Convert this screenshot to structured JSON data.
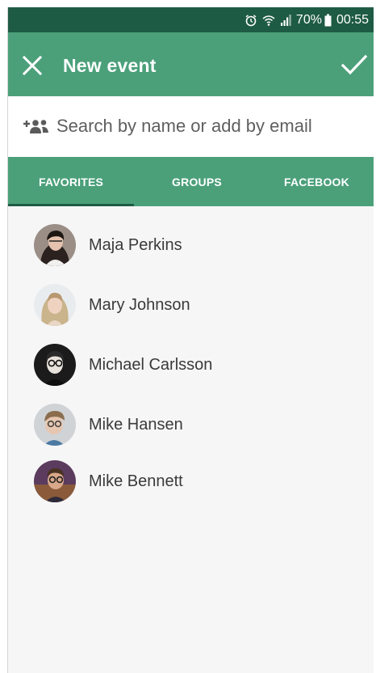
{
  "status_bar": {
    "battery": "70%",
    "time": "00:55",
    "icons": [
      "alarm-icon",
      "wifi-icon",
      "signal-icon",
      "battery-icon"
    ]
  },
  "app_bar": {
    "title": "New event",
    "close_icon": "close-icon",
    "confirm_icon": "check-icon"
  },
  "search": {
    "placeholder": "Search by name or add by email",
    "value": "",
    "icon": "add-people-icon"
  },
  "tabs": [
    {
      "label": "FAVORITES",
      "active": true
    },
    {
      "label": "GROUPS",
      "active": false
    },
    {
      "label": "FACEBOOK",
      "active": false
    }
  ],
  "contacts": [
    {
      "name": "Maja Perkins"
    },
    {
      "name": "Mary Johnson"
    },
    {
      "name": "Michael Carlsson"
    },
    {
      "name": "Mike Hansen"
    },
    {
      "name": "Mike Bennett"
    }
  ],
  "colors": {
    "status_bar": "#1e5b45",
    "primary": "#4ba07a",
    "tab_indicator": "#1f5c44",
    "background": "#f6f6f6"
  }
}
